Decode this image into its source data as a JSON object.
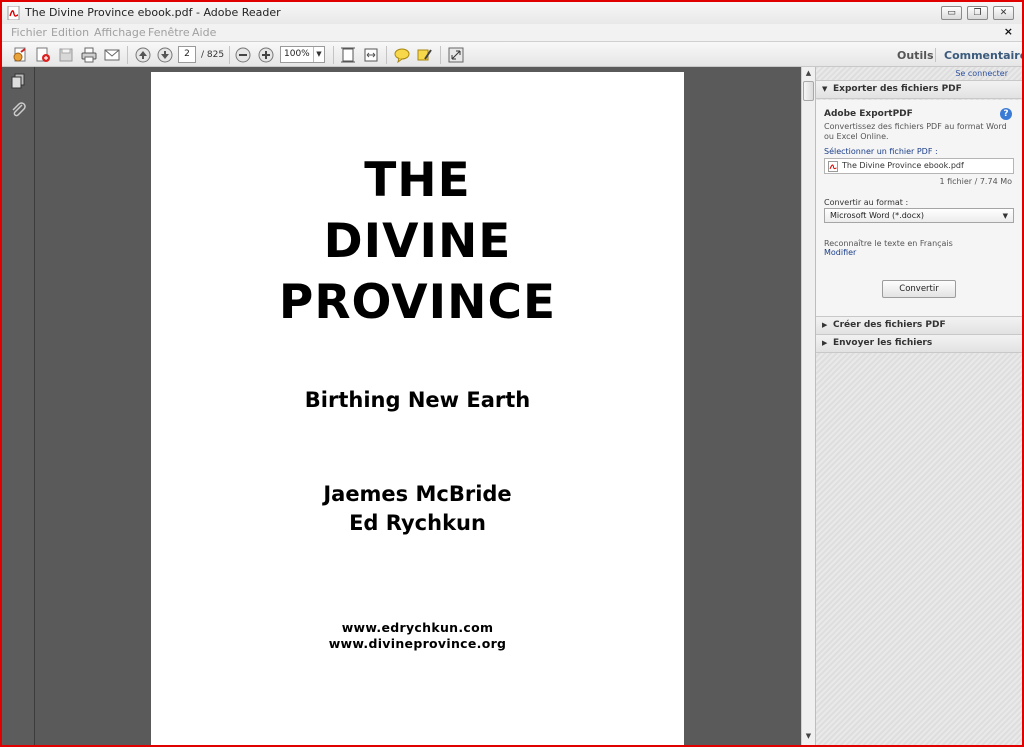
{
  "window": {
    "title": "The Divine Province ebook.pdf - Adobe Reader",
    "controls": [
      "minimize",
      "restore",
      "close"
    ],
    "minimize_glyph": "▭",
    "restore_glyph": "❐",
    "close_glyph": "✕"
  },
  "menubar": {
    "items": [
      "Fichier",
      "Edition",
      "Affichage",
      "Fenêtre",
      "Aide"
    ],
    "close_glyph": "×"
  },
  "toolbar": {
    "current_page": "2",
    "total_pages": "/ 825",
    "zoom": "100%",
    "zoom_arrow": "▼",
    "tabs": {
      "tools": "Outils",
      "comment": "Commentaire"
    },
    "icons": [
      "create-pdf-icon",
      "combine-pdf-icon",
      "save-icon",
      "print-icon",
      "email-icon",
      "previous-page-icon",
      "next-page-icon",
      "zoom-out-icon",
      "zoom-in-icon",
      "fit-page-icon",
      "full-width-icon",
      "comment-icon",
      "highlight-icon",
      "read-mode-icon"
    ]
  },
  "nav": {
    "icons": [
      "pages-icon",
      "attachments-icon"
    ]
  },
  "document": {
    "title_lines": [
      "THE",
      "DIVINE",
      "PROVINCE"
    ],
    "subtitle": "Birthing New Earth",
    "authors": [
      "Jaemes McBride",
      "Ed Rychkun"
    ],
    "urls": [
      "www.edrychkun.com",
      "www.divineprovince.org"
    ]
  },
  "scrollbar": {
    "up": "▲",
    "down": "▼"
  },
  "panel": {
    "connect": "Se connecter",
    "export": {
      "header": "Exporter des fichiers PDF",
      "tri": "▼",
      "title": "Adobe ExportPDF",
      "help": "?",
      "description": "Convertissez des fichiers PDF au format Word ou Excel Online.",
      "select_label": "Sélectionner un fichier PDF :",
      "file_name": "The Divine Province ebook.pdf",
      "file_count": "1 fichier / 7.74 Mo",
      "format_label": "Convertir au format :",
      "format_value": "Microsoft Word (*.docx)",
      "format_arrow": "▼",
      "ocr_text": "Reconnaître le texte en Français",
      "ocr_link": "Modifier",
      "convert_button": "Convertir"
    },
    "create": {
      "header": "Créer des fichiers PDF",
      "tri": "▶"
    },
    "send": {
      "header": "Envoyer les fichiers",
      "tri": "▶"
    }
  },
  "colors": {
    "frame": "#e00000",
    "doc_bg": "#5a5a5a",
    "link": "#1a3e8a",
    "tab_active": "#3b5a7c"
  }
}
